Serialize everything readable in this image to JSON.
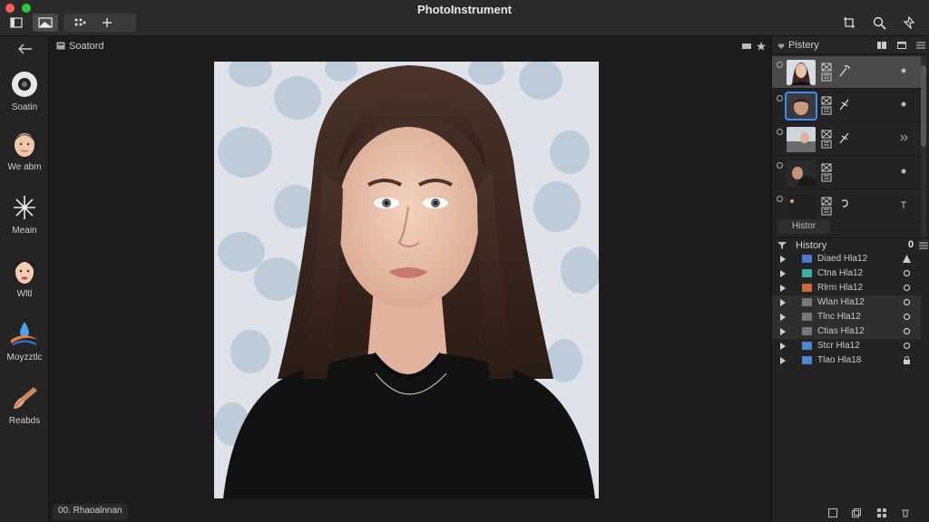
{
  "window": {
    "title": "PhotoInstrument"
  },
  "colors": {
    "accent": "#3c8cff",
    "background": "#1b1b1b",
    "panel": "#232323"
  },
  "titlebar": {
    "left_buttons": [
      "sidebar-toggle-icon",
      "compare-icon",
      "grid-dots-icon",
      "plus-icon"
    ],
    "right_icons": [
      "crop-icon",
      "search-icon",
      "pin-icon"
    ]
  },
  "toolbar": {
    "tools": [
      {
        "label": "Soatin",
        "icon": "circle-brush-icon"
      },
      {
        "label": "We abm",
        "icon": "face-icon"
      },
      {
        "label": "Meain",
        "icon": "clone-star-icon"
      },
      {
        "label": "Wltl",
        "icon": "makeup-face-icon"
      },
      {
        "label": "Moyzztlc",
        "icon": "liquify-drop-icon"
      },
      {
        "label": "Reabds",
        "icon": "paint-brush-icon"
      }
    ]
  },
  "canvas": {
    "title": "Soatord",
    "status": "00. Rhaoalnnan"
  },
  "right_panel": {
    "header": "Pistery",
    "history_tab": "Histor",
    "history_title": "History",
    "history_count": "0",
    "history_rows": [
      {
        "label": "Diaed Hla12",
        "state": "warning-triangle-icon",
        "color": "#4a7acb"
      },
      {
        "label": "Ctna Hla12",
        "state": "check-icon",
        "color": "#38b0a5"
      },
      {
        "label": "Rlrm Hla12",
        "state": "check-icon",
        "color": "#c86a3a"
      },
      {
        "label": "Wlan Hla12",
        "state": "check-icon",
        "color": "#777777"
      },
      {
        "label": "Tlnc Hla12",
        "state": "check-icon",
        "color": "#777777"
      },
      {
        "label": "Ctias Hla12",
        "state": "check-icon",
        "color": "#777777"
      },
      {
        "label": "Stcr Hla12",
        "state": "check-icon",
        "color": "#4d88cc"
      },
      {
        "label": "Tlao Hla18",
        "state": "lock-icon",
        "color": "#4d88cc"
      }
    ]
  }
}
